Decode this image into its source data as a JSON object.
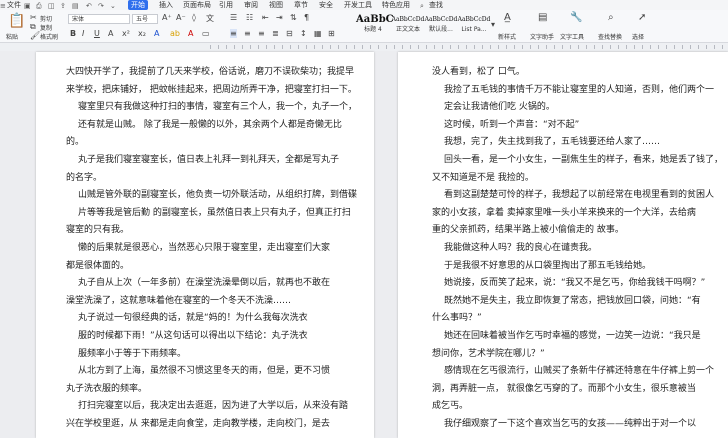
{
  "menubar": {
    "file": "文件",
    "tabs": [
      "开始",
      "插入",
      "页面布局",
      "引用",
      "审阅",
      "视图",
      "章节",
      "安全",
      "开发工具",
      "特色应用"
    ],
    "active_tab": "开始",
    "search": "查找"
  },
  "toolbar": {
    "paste": "粘贴",
    "cut": "剪切",
    "copy": "复制",
    "format_painter": "格式刷",
    "font_name": "宋体",
    "font_size": "五号",
    "styles": [
      {
        "preview": "AaBbC",
        "label": "标题 4"
      },
      {
        "preview": "AaBbCcDd",
        "label": "正文文本"
      },
      {
        "preview": "AaBbCcDd",
        "label": "默认段..."
      },
      {
        "preview": "AaBbCcDd",
        "label": "List Pa..."
      }
    ],
    "new_style": "新样式",
    "text_helper": "文字助手",
    "text_tools": "文字工具",
    "find_replace": "查找替换",
    "select": "选择"
  },
  "page_left": {
    "lines": [
      "大四快开学了，我提前了几天来学校，俗话说，磨刀不误砍柴功；我提早",
      "来学校，把床铺好，    把蚊帐挂起来，把周边所弄干净，把寝室打扫一下。",
      "寝室里只有我做这种打扫的事情，寝室有三个人，我一个，丸子一个，",
      "还有就是山贼。     除了我是一般懒的以外，其余两个人都是奇懒无比",
      "的。",
      "丸子是我们寝室寝室长，值日表上礼拜一到礼拜天，全都是写丸子",
      "的名字。",
      "山贼是管外联的副寝室长，他负责一切外联活动，从组织打牌，到借碟",
      "片等等我是管后勤    的副寝室长，虽然值日表上只有丸子，但真正打扫",
      "寝室的只有我。",
      "懒的后果就是很恶心，当然恶心只限于寝室里，走出寝室们大家",
      "都是很体面的。",
      "丸子自从上次（一年多前）在澡堂洗澡晕倒以后，就再也不敢在",
      "澡堂洗澡了，这就意味着他在寝室的一个冬天不洗澡……",
      "丸子说过一句很经典的话，就是“妈的！为什么我每次洗衣",
      "服的时候都下雨！”从这句话可以得出以下结论：丸子洗衣",
      "服频率小于等于下雨频率。",
      "从北方到了上海，虽然很不习惯这里冬天的雨，但是，更不习惯",
      "丸子洗衣服的频率。",
      "打扫完寝室以后，我决定出去逛逛，因为进了大学以后，从来没有踏",
      "兴在学校里逛，从    来都是走向食堂，走向教学楼，走向校门，是去"
    ]
  },
  "page_right": {
    "lines": [
      "没人看到，松了    口气。",
      "我捡了五毛钱的事情千万不能让寝室里的人知道，否则，他们两个一",
      "定会让我请他们吃    火锅的。",
      "这时候，听到一个声音：“对不起”",
      "我想，完了，失主找到我了，五毛钱要还给人家了……",
      "回头一看，是一个小女生，一副焦生生的样子，看来，她是丢了钱了，",
      "又不知道是不是    我捡的。",
      "看到这副楚楚可怜的样子，我想起了以前经常在电视里看到的贫困人",
      "家的小女孩，拿着    卖掉家里唯一头小羊来换来的一个大洋，去给病",
      "重的父亲抓药，结果半路上被小偷偷走的    故事。",
      "我能做这种人吗？我的良心在谴责我。",
      "于是我很不好意思的从口袋里掏出了那五毛钱给她。",
      "她说接，反而笑了起来，说：“我又不是乞丐，你给我钱干吗啊？”",
      "既然她不是失主，我立即恢复了常态，把钱放回口袋，问她：“有",
      "什么事吗？”",
      "她还在回味着被当作乞丐时幸福的感觉，一边笑一边说：“我只是",
      "想问你，艺术学院在哪儿？”",
      "感情现在乞丐很流行，山贼买了条新牛仔裤还特意在牛仔裤上剪一个",
      "洞，再弄脏一点，    就很像乞丐穿的了。而那个小女生，很乐意被当",
      "成乞丐。",
      "我仔细观察了一下这个喜欢当乞丐的女孩——纯粹出于对一个以"
    ]
  }
}
